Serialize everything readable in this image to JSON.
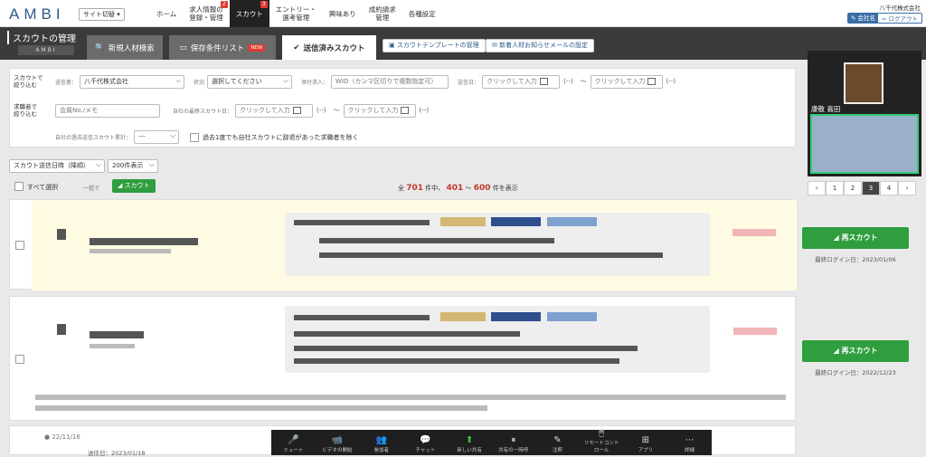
{
  "header": {
    "logo": "AMBI",
    "site_switch": "サイト切替 ▾",
    "nav": [
      {
        "label": "ホーム"
      },
      {
        "label": "求人情報の\n登録・管理",
        "badge": "2"
      },
      {
        "label": "スカウト",
        "badge": "3",
        "active": true
      },
      {
        "label": "エントリー・\n選考管理"
      },
      {
        "label": "興味あり"
      },
      {
        "label": "成約請求\n管理"
      },
      {
        "label": "各種設定"
      }
    ],
    "company": "八千代株式会社",
    "company_btn": "会社名",
    "logout_btn": "ログアウト"
  },
  "section": {
    "title": "スカウトの管理",
    "subtitle": "AMBI",
    "tabs": [
      "新規人材検索",
      "保存条件リスト",
      "送信済みスカウト"
    ],
    "new_badge": "NEW",
    "link_btns": [
      "スカウトテンプレートの管理",
      "新着人材お知らせメールの設定"
    ]
  },
  "filter": {
    "row1_label": "スカウトで\n絞り込む",
    "sender_label": "送信者：",
    "sender_value": "八千代株式会社",
    "status_label": "状況",
    "status_value": "選択してください",
    "job_label": "添付求人：",
    "job_placeholder": "WID（カンマ区切りで複数指定可）",
    "sent_label": "送信日：",
    "date_placeholder": "クリックして入力",
    "range_empty": "(--)",
    "tilde": "〜",
    "row2_label": "求職者で\n絞り込む",
    "member_placeholder": "会員No./メモ",
    "last_scout_label": "自社の最終スカウト日：",
    "past_count_label": "自社の過去送信スカウト累計：",
    "past_count_value": "---",
    "exclude_label": "過去1度でも自社スカウトに辞退があった求職者を除く"
  },
  "controls": {
    "sort_value": "スカウト送信日時（降順）",
    "per_page_value": "200件表示",
    "select_all": "すべて選択",
    "bulk_label": "一括で",
    "scout_btn": "スカウト",
    "count_prefix": "全",
    "count_total": "701",
    "count_mid": "件中、",
    "count_from": "401",
    "count_tilde": "〜",
    "count_to": "600",
    "count_suffix": "件を表示",
    "pages": [
      "‹",
      "1",
      "2",
      "3",
      "4",
      "›"
    ],
    "current_page": "3"
  },
  "cards": [
    {
      "rescout_btn": "再スカウト",
      "last_login": "最終ログイン日：2023/01/06"
    },
    {
      "rescout_btn": "再スカウト",
      "last_login": "最終ログイン日：2022/12/23"
    }
  ],
  "bottom_card": {
    "date": "22/11/16",
    "sent": "送信日：2023/01/18"
  },
  "video": {
    "name": "康敬 喜田"
  },
  "zoom": [
    {
      "icon": "🎤",
      "label": "ミュート"
    },
    {
      "icon": "📹",
      "label": "ビデオの開始"
    },
    {
      "icon": "👥",
      "label": "参加者"
    },
    {
      "icon": "💬",
      "label": "チャット"
    },
    {
      "icon": "⬆",
      "label": "新しい共有"
    },
    {
      "icon": "⏸",
      "label": "共有の一時停"
    },
    {
      "icon": "✎",
      "label": "注釈"
    },
    {
      "icon": "🖱",
      "label": "リモートコントロール"
    },
    {
      "icon": "⊞",
      "label": "アプリ"
    },
    {
      "icon": "⋯",
      "label": "詳細"
    }
  ]
}
